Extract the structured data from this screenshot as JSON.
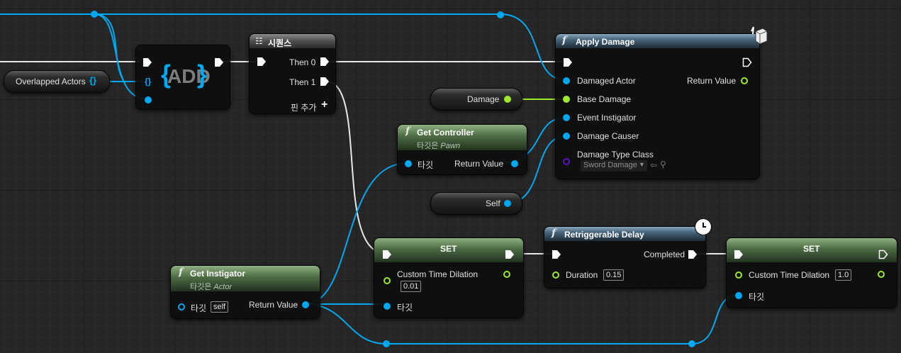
{
  "nodes": {
    "sequence": {
      "title": "시퀀스",
      "then0": "Then 0",
      "then1": "Then 1",
      "add_pin": "핀 추가"
    },
    "add": {
      "label": "ADD"
    },
    "overlapped": {
      "label": "Overlapped Actors"
    },
    "apply_damage": {
      "title": "Apply Damage",
      "damaged_actor": "Damaged Actor",
      "base_damage": "Base Damage",
      "event_instigator": "Event Instigator",
      "damage_causer": "Damage Causer",
      "damage_type_class": "Damage Type Class",
      "damage_type_value": "Sword Damage",
      "return_value": "Return Value"
    },
    "damage_var": {
      "label": "Damage"
    },
    "self_var": {
      "label": "Self"
    },
    "get_controller": {
      "title": "Get Controller",
      "subtitle_prefix": "타깃은 ",
      "subtitle_target": "Pawn",
      "target": "타깃",
      "return_value": "Return Value"
    },
    "get_instigator": {
      "title": "Get Instigator",
      "subtitle_prefix": "타깃은 ",
      "subtitle_target": "Actor",
      "target": "타깃",
      "target_value": "self",
      "return_value": "Return Value"
    },
    "set1": {
      "title": "SET",
      "field": "Custom Time Dilation",
      "value": "0.01",
      "target": "타깃"
    },
    "delay": {
      "title": "Retriggerable Delay",
      "completed": "Completed",
      "duration": "Duration",
      "duration_value": "0.15"
    },
    "set2": {
      "title": "SET",
      "field": "Custom Time Dilation",
      "value": "1.0",
      "target": "타깃"
    }
  },
  "colors": {
    "object_pin": "#00a8f0",
    "float_pin": "#9de92e",
    "class_pin": "#5b14b8",
    "exec_wire": "#ffffff"
  }
}
